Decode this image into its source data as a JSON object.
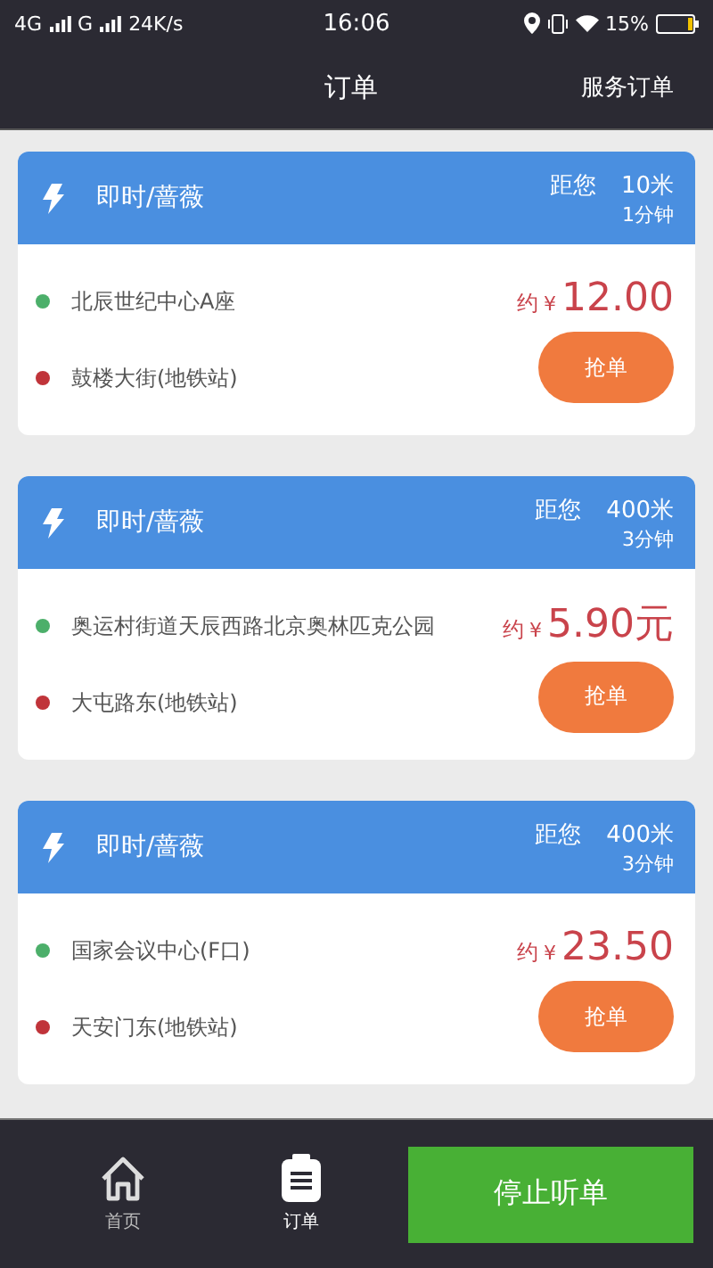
{
  "status_bar": {
    "network_1": "4G",
    "network_2": "G",
    "speed": "24K/s",
    "time": "16:06",
    "battery": "15%"
  },
  "header": {
    "title": "订单",
    "action": "服务订单"
  },
  "orders": [
    {
      "type": "即时/蔷薇",
      "distance_label": "距您",
      "distance": "10米",
      "eta": "1分钟",
      "from": "北辰世纪中心A座",
      "to": "鼓楼大街(地铁站)",
      "price_prefix": "约",
      "currency": "¥",
      "amount": "12.00",
      "button": "抢单"
    },
    {
      "type": "即时/蔷薇",
      "distance_label": "距您",
      "distance": "400米",
      "eta": "3分钟",
      "from": "奥运村街道天辰西路北京奥林匹克公园",
      "to": "大屯路东(地铁站)",
      "price_prefix": "约",
      "currency": "¥",
      "amount": "5.90元",
      "button": "抢单"
    },
    {
      "type": "即时/蔷薇",
      "distance_label": "距您",
      "distance": "400米",
      "eta": "3分钟",
      "from": "国家会议中心(F口)",
      "to": "天安门东(地铁站)",
      "price_prefix": "约",
      "currency": "¥",
      "amount": "23.50",
      "button": "抢单"
    }
  ],
  "tab_bar": {
    "tabs": [
      {
        "kind": "home",
        "label": "首页",
        "selected": false
      },
      {
        "kind": "orders",
        "label": "订单",
        "selected": true
      }
    ],
    "action": "停止听单"
  }
}
